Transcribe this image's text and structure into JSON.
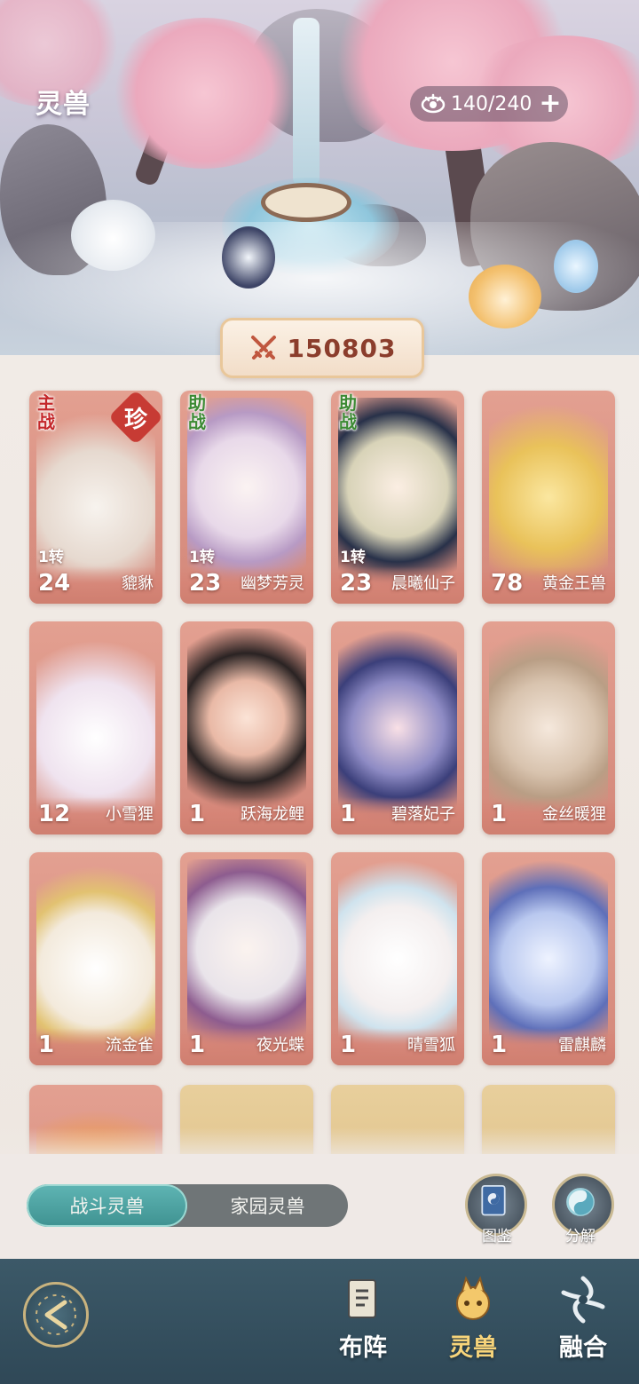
{
  "header": {
    "title": "灵兽",
    "capacity": "140/240",
    "capacity_plus": "+"
  },
  "power": {
    "value": "150803"
  },
  "cards": [
    {
      "level": "24",
      "name": "貔貅",
      "turn": "1转",
      "role": "主战",
      "rare": "珍",
      "color": "#e3a091"
    },
    {
      "level": "23",
      "name": "幽梦芳灵",
      "turn": "1转",
      "role": "助战",
      "rare": "",
      "color": "#e3a091"
    },
    {
      "level": "23",
      "name": "晨曦仙子",
      "turn": "1转",
      "role": "助战",
      "rare": "",
      "color": "#e3a091"
    },
    {
      "level": "78",
      "name": "黄金王兽",
      "turn": "",
      "role": "",
      "rare": "",
      "color": "#e3a091"
    },
    {
      "level": "12",
      "name": "小雪狸",
      "turn": "",
      "role": "",
      "rare": "",
      "color": "#e3a091"
    },
    {
      "level": "1",
      "name": "跃海龙鲤",
      "turn": "",
      "role": "",
      "rare": "",
      "color": "#e3a091"
    },
    {
      "level": "1",
      "name": "碧落妃子",
      "turn": "",
      "role": "",
      "rare": "",
      "color": "#e3a091"
    },
    {
      "level": "1",
      "name": "金丝暖狸",
      "turn": "",
      "role": "",
      "rare": "",
      "color": "#e3a091"
    },
    {
      "level": "1",
      "name": "流金雀",
      "turn": "",
      "role": "",
      "rare": "",
      "color": "#e3a091"
    },
    {
      "level": "1",
      "name": "夜光蝶",
      "turn": "",
      "role": "",
      "rare": "",
      "color": "#e3a091"
    },
    {
      "level": "1",
      "name": "晴雪狐",
      "turn": "",
      "role": "",
      "rare": "",
      "color": "#e3a091"
    },
    {
      "level": "1",
      "name": "雷麒麟",
      "turn": "",
      "role": "",
      "rare": "",
      "color": "#e3a091"
    }
  ],
  "tabs": {
    "battle": "战斗灵兽",
    "home": "家园灵兽"
  },
  "side_buttons": {
    "codex": "图鉴",
    "decompose": "分解"
  },
  "nav": {
    "formation": "布阵",
    "beasts": "灵兽",
    "fusion": "融合"
  }
}
